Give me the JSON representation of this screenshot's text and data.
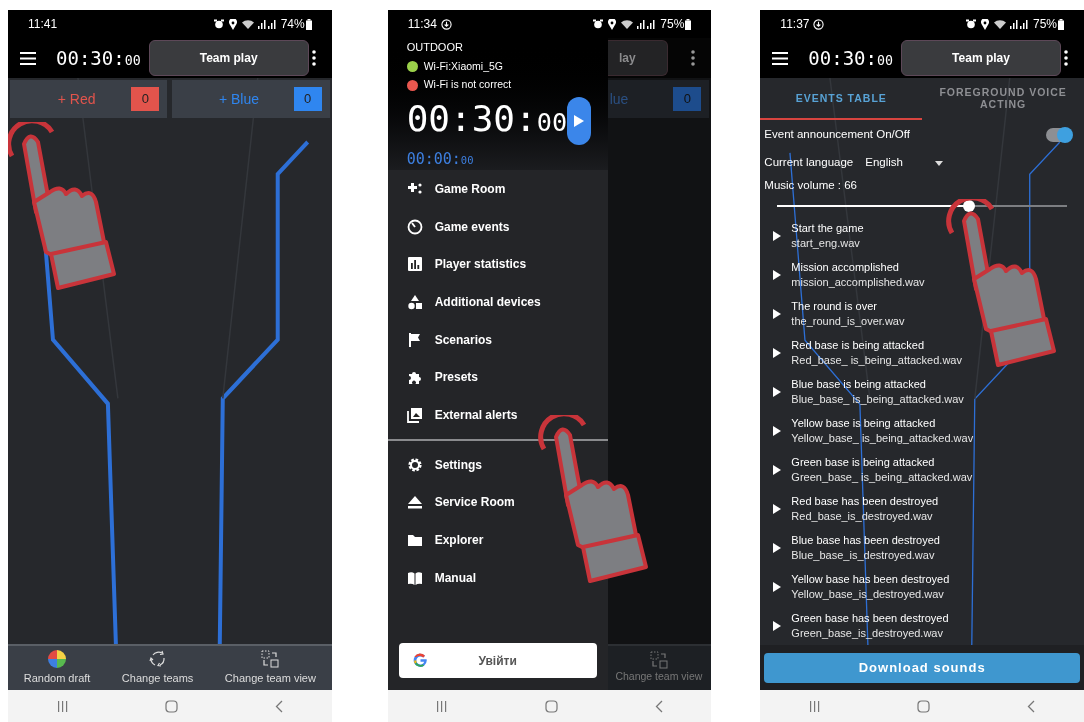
{
  "screen_main": {
    "status_bar": {
      "time": "11:41",
      "data_saver": false,
      "battery": "74%"
    },
    "timer": {
      "main": "00:30:",
      "fraction": "00"
    },
    "mode_button": "Team play",
    "teams": [
      {
        "label": "+ Red",
        "score": "0",
        "color": "#e2544c"
      },
      {
        "label": "+ Blue",
        "score": "0",
        "color": "#2f86f0"
      }
    ],
    "bottom_actions": [
      {
        "kind": "random",
        "label": "Random draft"
      },
      {
        "kind": "swap",
        "label": "Change teams"
      },
      {
        "kind": "view",
        "label": "Change team view"
      }
    ]
  },
  "screen_menu": {
    "status_bar": {
      "time": "11:34",
      "data_saver": true,
      "battery": "75%"
    },
    "venue": "OUTDOOR",
    "network": [
      {
        "text": "Wi-Fi:Xiaomi_5G",
        "color": "#9bd14a"
      },
      {
        "text": "Wi-Fi is not correct",
        "color": "#e8574f"
      }
    ],
    "timer": {
      "main": "00:30:",
      "fraction": "00"
    },
    "elapsed": {
      "main": "00:00:",
      "fraction": "00"
    },
    "menu_groups": [
      [
        {
          "kind": "gamepad",
          "label": "Game Room"
        },
        {
          "kind": "timer",
          "label": "Game events"
        },
        {
          "kind": "chart",
          "label": "Player statistics"
        },
        {
          "kind": "shapes",
          "label": "Additional devices"
        },
        {
          "kind": "flag",
          "label": "Scenarios"
        },
        {
          "kind": "puzzle",
          "label": "Presets"
        },
        {
          "kind": "picture",
          "label": "External alerts"
        }
      ],
      [
        {
          "kind": "gear",
          "label": "Settings"
        },
        {
          "kind": "eject",
          "label": "Service Room"
        },
        {
          "kind": "folder",
          "label": "Explorer"
        },
        {
          "kind": "book",
          "label": "Manual"
        }
      ]
    ],
    "sign_in": "Увійти",
    "behind": {
      "mode_button": "lay",
      "team": "lue",
      "score": "0",
      "action": "Change team view"
    }
  },
  "screen_sound": {
    "status_bar": {
      "time": "11:37",
      "data_saver": true,
      "battery": "75%"
    },
    "timer": {
      "main": "00:30:",
      "fraction": "00"
    },
    "mode_button": "Team play",
    "tabs": [
      {
        "label": "EVENTS TABLE",
        "selected": true
      },
      {
        "label": "FOREGROUND VOICE ACTING",
        "selected": false
      }
    ],
    "announcement": {
      "label": "Event announcement On/Off",
      "on": true
    },
    "language": {
      "label": "Current language",
      "value": "English"
    },
    "volume": {
      "label": "Music volume : 66",
      "level": 0.66
    },
    "events": [
      {
        "title": "Start the game",
        "file": "start_eng.wav"
      },
      {
        "title": "Mission accomplished",
        "file": "mission_accomplished.wav"
      },
      {
        "title": "The round is over",
        "file": "the_round_is_over.wav"
      },
      {
        "title": "Red base is being attacked",
        "file": "Red_base_ is_being_attacked.wav"
      },
      {
        "title": "Blue base is being attacked",
        "file": "Blue_base_ is_being_attacked.wav"
      },
      {
        "title": "Yellow base is being attacked",
        "file": "Yellow_base_ is_being_attacked.wav"
      },
      {
        "title": "Green base is being attacked",
        "file": "Green_base_ is_being_attacked.wav"
      },
      {
        "title": "Red base has been destroyed",
        "file": "Red_base_is_destroyed.wav"
      },
      {
        "title": "Blue base has been destroyed",
        "file": "Blue_base_is_destroyed.wav"
      },
      {
        "title": "Yellow base has been destroyed",
        "file": "Yellow_base_is_destroyed.wav"
      },
      {
        "title": "Green base has been destroyed",
        "file": "Green_base_is_destroyed.wav"
      }
    ],
    "download_button": "Download sounds"
  }
}
